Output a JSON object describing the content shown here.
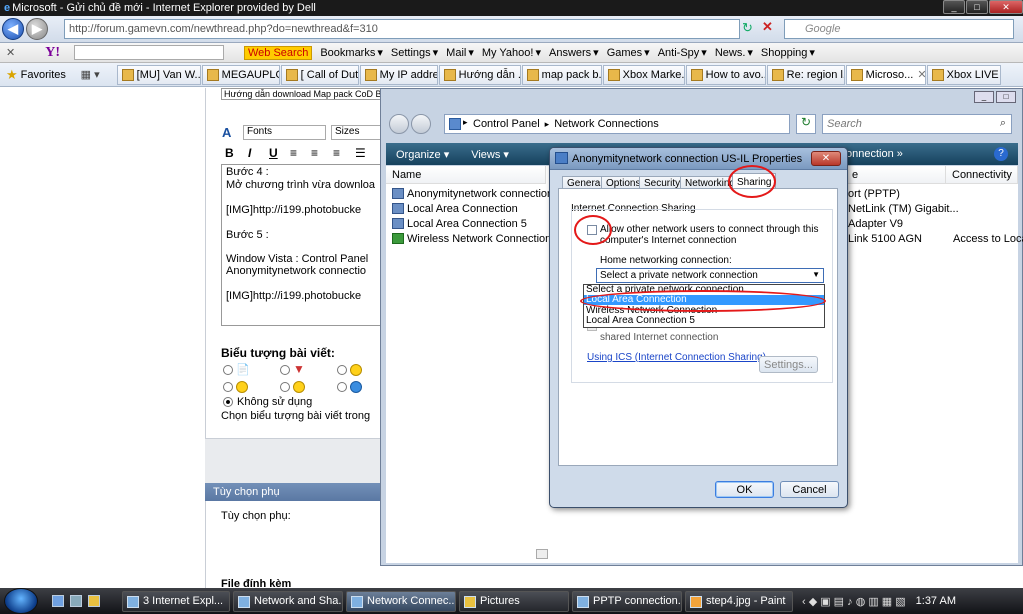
{
  "ie": {
    "title": "Microsoft - Gửi chủ đề mới - Internet Explorer provided by Dell",
    "url": "http://forum.gamevn.com/newthread.php?do=newthread&f=310",
    "google_placeholder": "Google"
  },
  "yahoo_toolbar": {
    "logo": "Y!",
    "web_search": "Web Search",
    "items": [
      "Bookmarks",
      "Settings",
      "Mail",
      "My Yahoo!",
      "Answers",
      "Games",
      "Anti-Spy",
      "News.",
      "Shopping"
    ]
  },
  "favorites": {
    "label": "Favorites",
    "tabs": [
      "[MU] Van W...",
      "MEGAUPLO...",
      "[ Call of Dut...",
      "My IP addre...",
      "Hướng dẫn ...",
      "map pack b...",
      "Xbox Marke...",
      "How to avo...",
      "Re: region l...",
      "Microso...",
      "Xbox LIVE R..."
    ]
  },
  "webpage": {
    "post_title_value": "Hướng dẫn download Map pack CoD Black Ops",
    "font_label": "Fonts",
    "size_label": "Sizes",
    "editor_lines": [
      "Bước 4 :",
      "Mở chương trình vừa downloa",
      "[IMG]http://i199.photobucke",
      "Bước 5 :",
      "Window Vista : Control Panel",
      "Anonymitynetwork connectio",
      "[IMG]http://i199.photobucke"
    ],
    "icon_section_title": "Biểu tượng bài viết:",
    "no_icon_label": "Không sử dụng",
    "choose_icon_text": "Chọn biểu tượng bài viết trong",
    "options_header": "Tùy chọn phụ",
    "options_label": "Tùy chọn phụ:",
    "attachments_label": "File đính kèm"
  },
  "explorer": {
    "breadcrumb": [
      "Control Panel",
      "Network Connections"
    ],
    "search_placeholder": "Search",
    "toolbar": {
      "organize": "Organize",
      "views": "Views",
      "connection": "onnection"
    },
    "columns": {
      "name": "Name",
      "device": "e",
      "connectivity": "Connectivity"
    },
    "items": [
      "Anonymitynetwork connection U",
      "Local Area Connection",
      "Local Area Connection 5",
      "Wireless Network Connection"
    ],
    "device_col": [
      "ort (PPTP)",
      "NetLink (TM) Gigabit...",
      "Adapter V9",
      "Link 5100 AGN"
    ],
    "connectivity_col": [
      "",
      "",
      "",
      "Access to Loca"
    ]
  },
  "dialog": {
    "title": "Anonymitynetwork connection US-IL Properties",
    "tabs": [
      "General",
      "Options",
      "Security",
      "Networking",
      "Sharing"
    ],
    "active_tab": "Sharing",
    "section_title": "Internet Connection Sharing",
    "allow_line1": "Allow other network users to connect through this",
    "allow_line2": "computer's Internet connection",
    "home_label": "Home networking connection:",
    "dropdown_value": "Select a private network connection",
    "dropdown_options": [
      "Select a private network connection",
      "Local Area Connection",
      "Wireless Network Connection",
      "Local Area Connection 5"
    ],
    "selected_option": "Local Area Connection",
    "shared_text": "shared Internet connection",
    "ics_link": "Using ICS (Internet Connection Sharing)",
    "settings_btn": "Settings...",
    "ok_btn": "OK",
    "cancel_btn": "Cancel"
  },
  "taskbar": {
    "tasks": [
      "3 Internet Expl...",
      "Network and Sha...",
      "Network Connec...",
      "Pictures",
      "PPTP connection...",
      "step4.jpg - Paint"
    ],
    "active_task": "Network Connec...",
    "time": "1:37 AM"
  }
}
